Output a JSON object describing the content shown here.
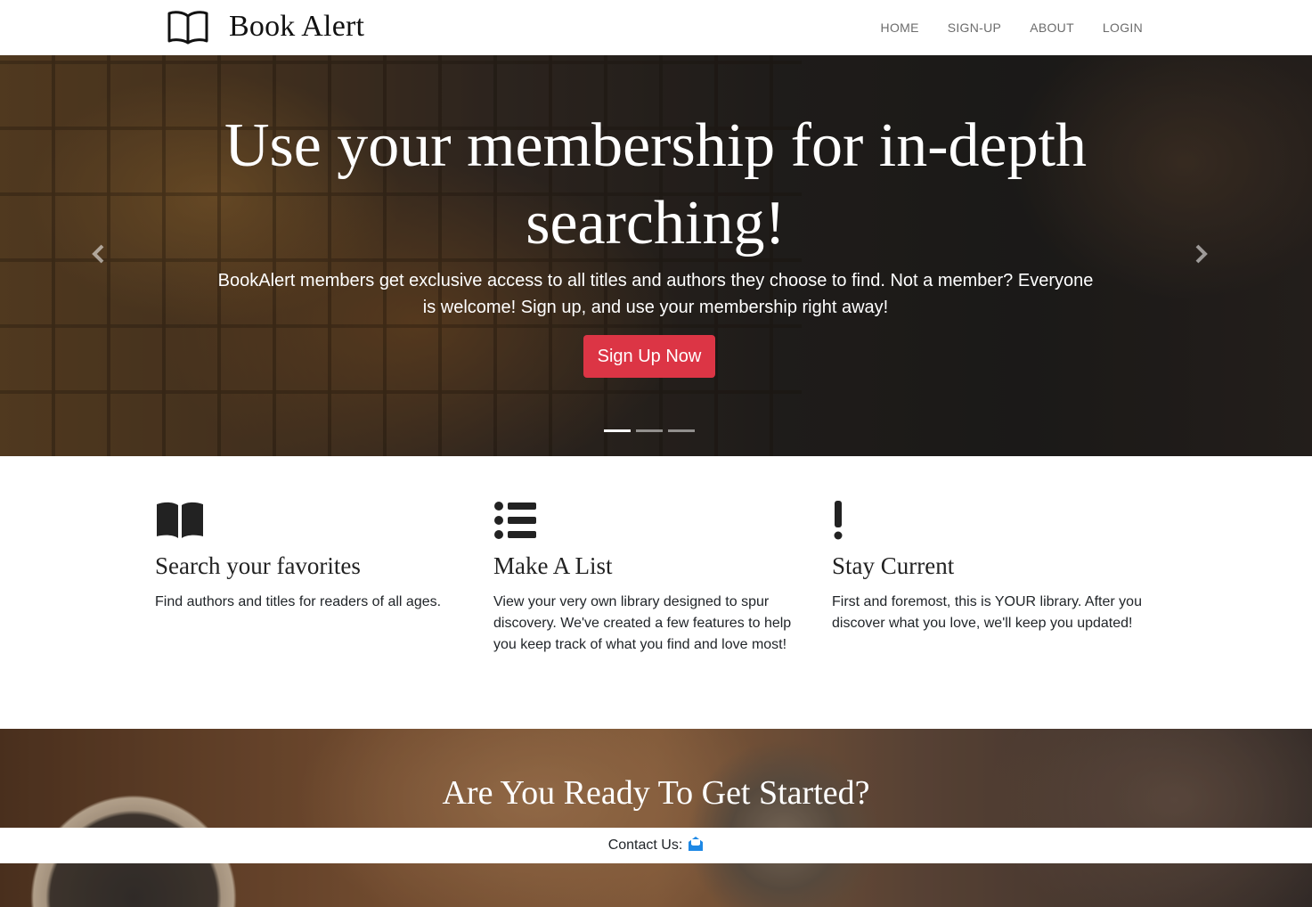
{
  "navbar": {
    "brand": "Book Alert",
    "brand_icon": "open-book-icon",
    "links": [
      "HOME",
      "SIGN-UP",
      "ABOUT",
      "LOGIN"
    ]
  },
  "hero": {
    "title": "Use your membership for in-depth searching!",
    "text": "BookAlert members get exclusive access to all titles and authors they choose to find. Not a member? Everyone is welcome! Sign up, and use your membership right away!",
    "button_label": "Sign Up Now",
    "prev_icon": "chevron-left-icon",
    "next_icon": "chevron-right-icon",
    "slide_count": 3,
    "active_slide": 1
  },
  "features": [
    {
      "icon": "book-icon",
      "title": "Search your favorites",
      "text": "Find authors and titles for readers of all ages."
    },
    {
      "icon": "list-icon",
      "title": "Make A List",
      "text": "View your very own library designed to spur discovery. We've created a few features to help you keep track of what you find and love most!"
    },
    {
      "icon": "exclamation-icon",
      "title": "Stay Current",
      "text": "First and foremost, this is YOUR library. After you discover what you love, we'll keep you updated!"
    }
  ],
  "cta": {
    "title": "Are You Ready To Get Started?"
  },
  "footer": {
    "contact_label": "Contact Us:",
    "contact_icon": "envelope-open-icon"
  },
  "colors": {
    "accent": "#dc3545",
    "nav_link": "#6c6c6c",
    "contact_icon": "#1e88e5"
  }
}
